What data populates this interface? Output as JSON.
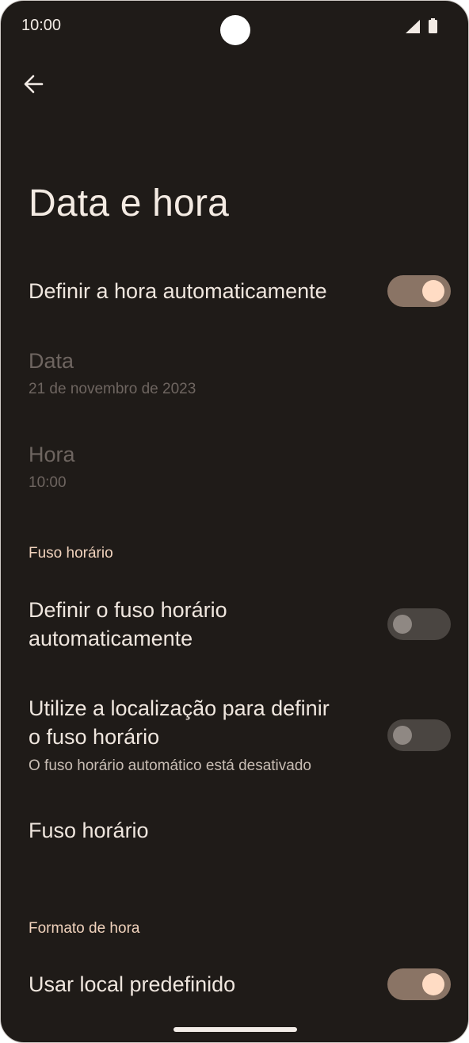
{
  "status": {
    "time": "10:00"
  },
  "header": {
    "title": "Data e hora"
  },
  "settings": {
    "auto_time": {
      "label": "Definir a hora automaticamente",
      "state": "on"
    },
    "date": {
      "label": "Data",
      "value": "21 de novembro de 2023"
    },
    "time": {
      "label": "Hora",
      "value": "10:00"
    },
    "timezone_section": "Fuso horário",
    "auto_timezone": {
      "label_line1": "Definir o fuso horário",
      "label_line2": "automaticamente",
      "state": "off"
    },
    "location_timezone": {
      "label_line1": "Utilize a localização para definir",
      "label_line2": "o fuso horário",
      "summary": "O fuso horário automático está desativado",
      "state": "off"
    },
    "timezone": {
      "label": "Fuso horário"
    },
    "format_section": "Formato de hora",
    "locale_default": {
      "label": "Usar local predefinido",
      "state": "on"
    }
  },
  "icons": [
    "back-arrow-icon",
    "signal-icon",
    "battery-icon"
  ],
  "colors": {
    "background": "#1f1b18",
    "accent": "#ffdcc4",
    "section": "#f1d3bd"
  }
}
